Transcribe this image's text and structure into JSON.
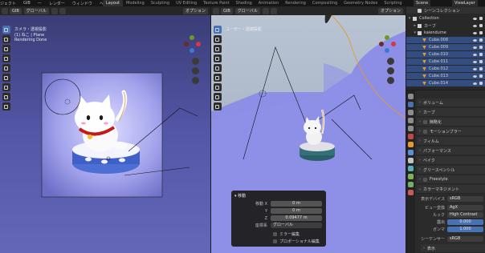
{
  "topbar": {
    "menus": [
      "ジェクト",
      "GIB",
      "ー",
      "レンダー",
      "ウィンドウ",
      "ヘルプ"
    ],
    "workspaces": [
      "Layout",
      "Modeling",
      "Sculpting",
      "UV Editing",
      "Texture Paint",
      "Shading",
      "Animation",
      "Rendering",
      "Compositing",
      "Geometry Nodes",
      "Scripting"
    ],
    "active_workspace": "Layout",
    "scene_name": "Scene",
    "view_layer": "ViewLayer"
  },
  "left_viewport": {
    "header": {
      "pivot": "グローバル",
      "options": "オプション"
    },
    "overlay": {
      "camera": "カメラ・透視投影",
      "collection": "(1) ねこ | Plane",
      "status": "Rendering Done"
    }
  },
  "right_viewport": {
    "header": {
      "pivot": "グローバル",
      "options": "オプション"
    },
    "overlay": {
      "view": "ユーザー・透視投影"
    }
  },
  "operator_panel": {
    "title": "移動",
    "rows": [
      {
        "label": "移動 X",
        "value": "0 m"
      },
      {
        "label": "Y",
        "value": "0 m"
      },
      {
        "label": "Z",
        "value": "0.09477 m"
      },
      {
        "label": "座標系",
        "value": "グローバル"
      }
    ],
    "checks": [
      "ミラー編集",
      "プロポーショナル編集"
    ]
  },
  "outliner": {
    "header": "シーンコレクション",
    "items": [
      {
        "name": "Collection",
        "sel": false
      },
      {
        "name": "カーブ",
        "sel": false
      },
      {
        "name": "kaiendume",
        "sel": false
      },
      {
        "name": "Cube.008",
        "sel": true
      },
      {
        "name": "Cube.009",
        "sel": true
      },
      {
        "name": "Cube.010",
        "sel": true
      },
      {
        "name": "Cube.011",
        "sel": true
      },
      {
        "name": "Cube.012",
        "sel": true
      },
      {
        "name": "Cube.013",
        "sel": true
      },
      {
        "name": "Cube.014",
        "sel": true
      }
    ]
  },
  "properties": {
    "panels": [
      "ボリューム",
      "カーブ",
      "簡略化",
      "モーションブラー",
      "フィルム",
      "パフォーマンス",
      "ベイク",
      "グリースペンシル",
      "Freestyle",
      "カラーマネジメント"
    ],
    "color_management": [
      {
        "label": "表示デバイス",
        "value": "sRGB"
      },
      {
        "label": "ビュー変換",
        "value": "AgX"
      },
      {
        "label": "ルック",
        "value": "High Contrast"
      },
      {
        "label": "露出",
        "value": "0.000"
      },
      {
        "label": "ガンマ",
        "value": "1.000"
      },
      {
        "label": "シーケンサー",
        "value": "sRGB"
      }
    ],
    "subpanel": "表示"
  },
  "colors": {
    "accent": "#4772b3",
    "object_orange": "#e39a2e",
    "collar_red": "#c41a1a"
  }
}
